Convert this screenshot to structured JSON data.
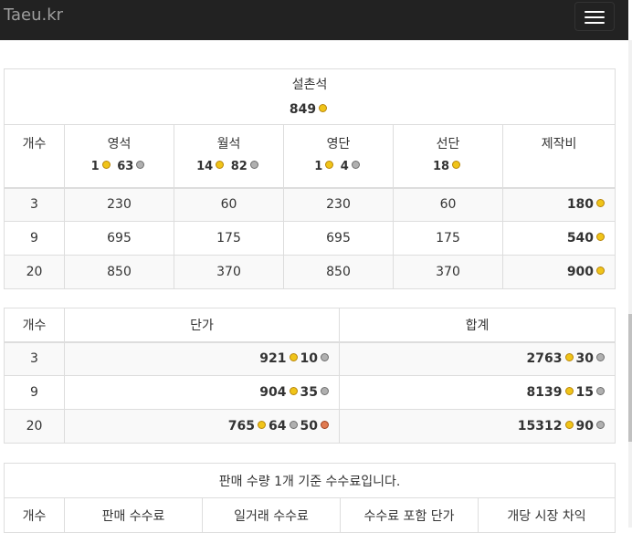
{
  "navbar": {
    "brand": "Taeu.kr"
  },
  "colors": {
    "navbar_bg": "#222222",
    "gold": "#f0c419",
    "silver": "#b0b0b0",
    "copper": "#e07a50"
  },
  "recipe_table": {
    "title": "설촌석",
    "title_price_gold": "849",
    "headers": [
      "개수",
      "영석",
      "월석",
      "영단",
      "선단",
      "제작비"
    ],
    "header_prices": [
      {
        "gold": "1",
        "silver": "63"
      },
      {
        "gold": "14",
        "silver": "82"
      },
      {
        "gold": "1",
        "silver": "4"
      },
      {
        "gold": "18"
      }
    ],
    "rows": [
      {
        "count": "3",
        "a": "230",
        "b": "60",
        "c": "230",
        "d": "60",
        "cost_gold": "180"
      },
      {
        "count": "9",
        "a": "695",
        "b": "175",
        "c": "695",
        "d": "175",
        "cost_gold": "540"
      },
      {
        "count": "20",
        "a": "850",
        "b": "370",
        "c": "850",
        "d": "370",
        "cost_gold": "900"
      }
    ]
  },
  "unit_table": {
    "headers": [
      "개수",
      "단가",
      "합계"
    ],
    "rows": [
      {
        "count": "3",
        "unit_gold": "921",
        "unit_silver": "10",
        "total_gold": "2763",
        "total_silver": "30"
      },
      {
        "count": "9",
        "unit_gold": "904",
        "unit_silver": "35",
        "total_gold": "8139",
        "total_silver": "15"
      },
      {
        "count": "20",
        "unit_gold": "765",
        "unit_silver": "64",
        "unit_copper": "50",
        "total_gold": "15312",
        "total_silver": "90"
      }
    ]
  },
  "fee_table": {
    "caption": "판매 수량 1개 기준 수수료입니다.",
    "headers": [
      "개수",
      "판매 수수료",
      "일거래 수수료",
      "수수료 포함 단가",
      "개당 시장 차익"
    ]
  }
}
